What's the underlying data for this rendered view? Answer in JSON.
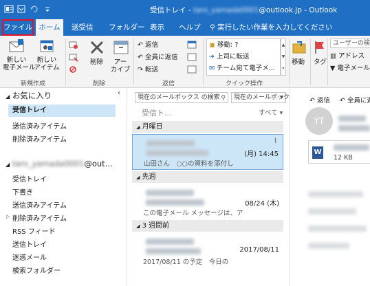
{
  "titlebar": {
    "title_prefix": "受信トレイ - ",
    "email_blurred": "taro_yamada0001",
    "email_domain": "@outlook.jp - Outlook"
  },
  "tabs": {
    "file": "ファイル",
    "home": "ホーム",
    "send_receive": "送受信",
    "folder": "フォルダー",
    "view": "表示",
    "help": "ヘルプ",
    "tell_me": "実行したい作業を入力してください"
  },
  "ribbon": {
    "new_email": [
      "新しい",
      "電子メール"
    ],
    "new_items": [
      "新しい",
      "アイテム"
    ],
    "delete": "削除",
    "archive": [
      "アー",
      "カイブ"
    ],
    "reply": "返信",
    "reply_all": "全員に返信",
    "forward": "転送",
    "quick1": "移動: ?",
    "quick2": "上司に転送",
    "quick3": "チーム宛て電子メ...",
    "move": "移動",
    "tags": "タグ",
    "search_people": "ユーザーの検",
    "address_book": "アドレス",
    "filter_email": "電子メール",
    "groups": {
      "new": "新規作成",
      "delete": "削除",
      "respond": "返信",
      "quick_steps": "クイック操作"
    }
  },
  "folders": {
    "favorites": "お気に入り",
    "fav_items": [
      "受信トレイ",
      "送信済みアイテム",
      "削除済みアイテム"
    ],
    "account_blurred": "taro_yamada0001",
    "account_suffix": "@out...",
    "account_items": [
      "受信トレイ",
      "下書き",
      "送信済みアイテム",
      "削除済みアイテム",
      "RSS フィード",
      "送信トレイ",
      "迷惑メール",
      "検索フォルダー"
    ]
  },
  "list": {
    "search_placeholder": "現在のメールボックス の検索",
    "scope": "現在のメールボックス",
    "header_inbox": "受信ト...",
    "all": "すべて ▾",
    "groups": [
      "月曜日",
      "先週",
      "3 週間前"
    ],
    "messages": [
      {
        "date": "(月) 14:45",
        "preview": "山田さん　○○の資料を添付し"
      },
      {
        "date": "08/24 (木)",
        "preview": "この電子メール メッセージは、ア"
      },
      {
        "date": "2017/08/11",
        "preview": "2017/08/11 の予定　今日の"
      }
    ]
  },
  "reading": {
    "reply": "返信",
    "reply_all": "全員に返",
    "avatar_initials": "YT",
    "attachment_size": "12 KB"
  },
  "colors": {
    "brand": "#1f6fc5",
    "selected": "#cde6f7",
    "file_tab_outline": "#e81123"
  }
}
